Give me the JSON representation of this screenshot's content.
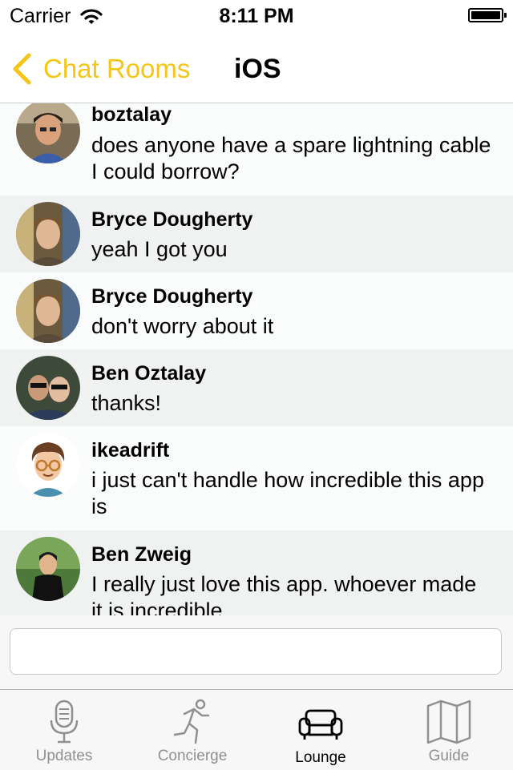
{
  "status_bar": {
    "carrier": "Carrier",
    "time": "8:11 PM"
  },
  "nav": {
    "back_label": "Chat Rooms",
    "title": "iOS"
  },
  "messages": [
    {
      "name": "boztalay",
      "text": "does anyone have a spare lightning cable I could borrow?"
    },
    {
      "name": "Bryce Dougherty",
      "text": "yeah I got you"
    },
    {
      "name": "Bryce Dougherty",
      "text": "don't worry about it"
    },
    {
      "name": "Ben Oztalay",
      "text": "thanks!"
    },
    {
      "name": "ikeadrift",
      "text": "i just can't handle how incredible this app is"
    },
    {
      "name": "Ben Zweig",
      "text": "I really just love this app. whoever made it is incredible"
    }
  ],
  "composer": {
    "value": "",
    "placeholder": ""
  },
  "tabs": [
    {
      "label": "Updates",
      "icon": "microphone-icon"
    },
    {
      "label": "Concierge",
      "icon": "runner-icon"
    },
    {
      "label": "Lounge",
      "icon": "sofa-icon",
      "active": true
    },
    {
      "label": "Guide",
      "icon": "map-icon"
    }
  ],
  "colors": {
    "accent": "#f5c518",
    "row_alt": "#f0f2f2",
    "row": "#fafbfb",
    "tab_inactive": "#909090"
  }
}
